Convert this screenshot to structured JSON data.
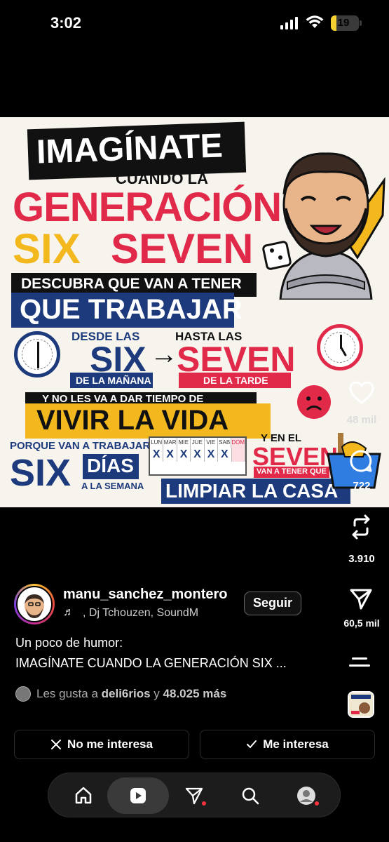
{
  "status_bar": {
    "time": "3:02",
    "battery_level": "19"
  },
  "post_image": {
    "imaginate": "IMAGÍNATE",
    "cuando_la": "CUANDO LA",
    "generacion": "GENERACIÓN",
    "six": "SIX",
    "seven": "SEVEN",
    "descubra": "DESCUBRA QUE VAN A TENER",
    "que_trabajar": "QUE TRABAJAR",
    "desde_las": "DESDE LAS",
    "six_big": "SIX",
    "de_la_manana": "DE LA MAÑANA",
    "arrow": "→",
    "hasta_las": "HASTA LAS",
    "seven_big": "SEVEN",
    "de_la_tarde": "DE LA TARDE",
    "no_les_va": "Y NO LES VA A DAR TIEMPO DE",
    "vivir_la_vida": "VIVIR LA VIDA",
    "porque": "PORQUE VAN A TRABAJAR",
    "six_mid": "SIX",
    "dias": "DÍAS",
    "a_la_semana": "A LA SEMANA",
    "y_en_el": "Y EN EL",
    "seven_mid": "SEVEN",
    "van_a_tener_que": "VAN A TENER QUE",
    "limpiar_la_casa": "LIMPIAR LA CASA",
    "calendar": {
      "days": [
        "LUN",
        "MAR",
        "MIE",
        "JUE",
        "VIE",
        "SAB",
        "DOM"
      ],
      "marks": [
        "X",
        "X",
        "X",
        "X",
        "X",
        "X",
        ""
      ]
    }
  },
  "actions": {
    "likes": "48 mil",
    "comments": "722",
    "reposts": "3.910",
    "shares": "60,5 mil"
  },
  "author": {
    "username": "manu_sanchez_montero",
    "music_note": "♬",
    "audio": ", Dj Tchouzen, SoundM",
    "follow_label": "Seguir"
  },
  "caption": {
    "line1": "Un poco de humor:",
    "line2": "IMAGÍNATE CUANDO LA GENERACIÓN SIX ..."
  },
  "likes_row": {
    "prefix": "Les gusta a",
    "user": "deli6rios",
    "connector": "y",
    "rest": "48.025 más"
  },
  "interest": {
    "not_interested": "No me interesa",
    "interested": "Me interesa"
  },
  "nav": {
    "items": [
      "home-icon",
      "reels-icon",
      "direct-icon",
      "search-icon",
      "profile-icon"
    ],
    "active": "reels-icon"
  },
  "colors": {
    "accent_red": "#e1294a",
    "accent_blue": "#1d3b7c",
    "accent_yellow": "#f2b81d",
    "notification": "#ff3040"
  }
}
